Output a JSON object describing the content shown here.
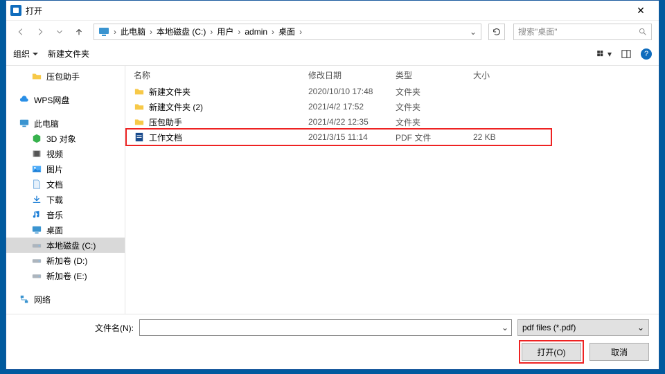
{
  "titlebar": {
    "title": "打开"
  },
  "breadcrumbs": [
    "此电脑",
    "本地磁盘 (C:)",
    "用户",
    "admin",
    "桌面"
  ],
  "search": {
    "placeholder": "搜索\"桌面\""
  },
  "toolbar": {
    "organize": "组织",
    "newfolder": "新建文件夹"
  },
  "columns": {
    "name": "名称",
    "date": "修改日期",
    "type": "类型",
    "size": "大小"
  },
  "tree": {
    "compress": "压包助手",
    "wps": "WPS网盘",
    "thispc": "此电脑",
    "obj3d": "3D 对象",
    "video": "视频",
    "pictures": "图片",
    "documents": "文档",
    "downloads": "下载",
    "music": "音乐",
    "desktop": "桌面",
    "cdrive": "本地磁盘 (C:)",
    "ddrive": "新加卷 (D:)",
    "edrive": "新加卷 (E:)",
    "network": "网络"
  },
  "rows": [
    {
      "name": "新建文件夹",
      "date": "2020/10/10 17:48",
      "type": "文件夹",
      "size": ""
    },
    {
      "name": "新建文件夹 (2)",
      "date": "2021/4/2 17:52",
      "type": "文件夹",
      "size": ""
    },
    {
      "name": "压包助手",
      "date": "2021/4/22 12:35",
      "type": "文件夹",
      "size": ""
    },
    {
      "name": "工作文档",
      "date": "2021/3/15 11:14",
      "type": "PDF 文件",
      "size": "22 KB"
    }
  ],
  "footer": {
    "filename_label": "文件名(N):",
    "filetype": "pdf files (*.pdf)",
    "open": "打开(O)",
    "cancel": "取消"
  }
}
